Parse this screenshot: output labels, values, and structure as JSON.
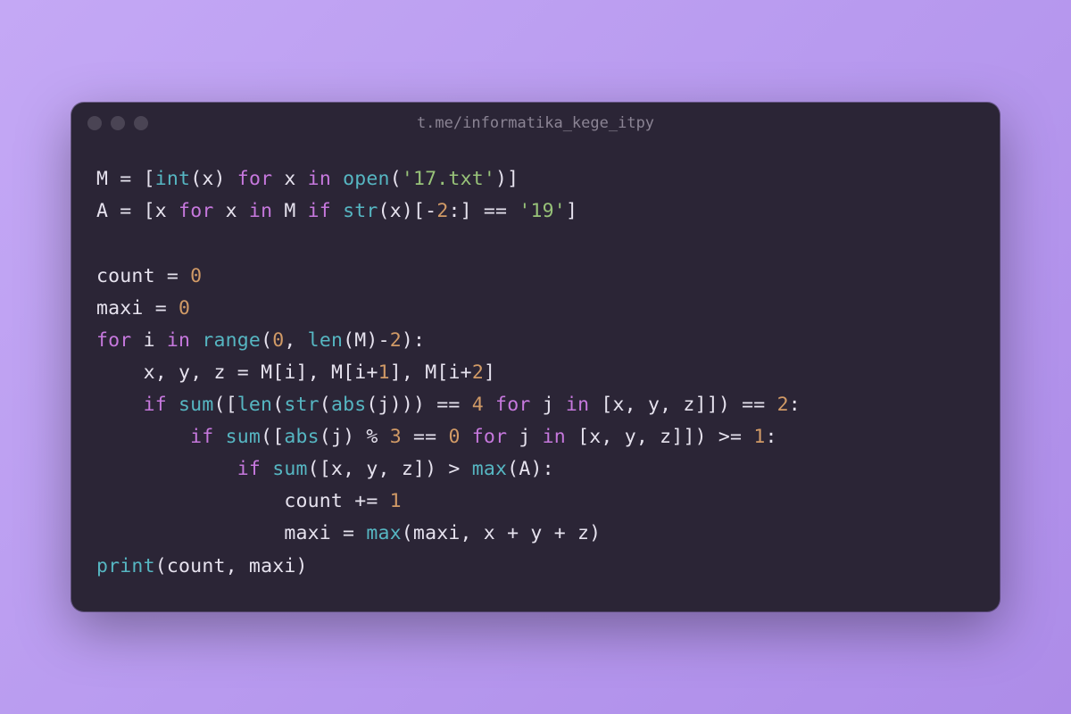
{
  "window": {
    "title": "t.me/informatika_kege_itpy"
  },
  "code": {
    "tokens": [
      [
        [
          "var",
          "M"
        ],
        [
          "op",
          " = "
        ],
        [
          "punc",
          "["
        ],
        [
          "builtin",
          "int"
        ],
        [
          "punc",
          "("
        ],
        [
          "var",
          "x"
        ],
        [
          "punc",
          ") "
        ],
        [
          "kw",
          "for"
        ],
        [
          "var",
          " x "
        ],
        [
          "kw",
          "in"
        ],
        [
          "punc",
          " "
        ],
        [
          "builtin",
          "open"
        ],
        [
          "punc",
          "("
        ],
        [
          "str",
          "'17.txt'"
        ],
        [
          "punc",
          ")]"
        ]
      ],
      [
        [
          "var",
          "A"
        ],
        [
          "op",
          " = "
        ],
        [
          "punc",
          "["
        ],
        [
          "var",
          "x "
        ],
        [
          "kw",
          "for"
        ],
        [
          "var",
          " x "
        ],
        [
          "kw",
          "in"
        ],
        [
          "var",
          " M "
        ],
        [
          "kw",
          "if"
        ],
        [
          "punc",
          " "
        ],
        [
          "builtin",
          "str"
        ],
        [
          "punc",
          "("
        ],
        [
          "var",
          "x"
        ],
        [
          "punc",
          ")["
        ],
        [
          "op",
          "-"
        ],
        [
          "num",
          "2"
        ],
        [
          "punc",
          ":] "
        ],
        [
          "op",
          "=="
        ],
        [
          "punc",
          " "
        ],
        [
          "str",
          "'19'"
        ],
        [
          "punc",
          "]"
        ]
      ],
      [],
      [
        [
          "var",
          "count"
        ],
        [
          "op",
          " = "
        ],
        [
          "num",
          "0"
        ]
      ],
      [
        [
          "var",
          "maxi"
        ],
        [
          "op",
          " = "
        ],
        [
          "num",
          "0"
        ]
      ],
      [
        [
          "kw",
          "for"
        ],
        [
          "var",
          " i "
        ],
        [
          "kw",
          "in"
        ],
        [
          "punc",
          " "
        ],
        [
          "builtin",
          "range"
        ],
        [
          "punc",
          "("
        ],
        [
          "num",
          "0"
        ],
        [
          "punc",
          ", "
        ],
        [
          "builtin",
          "len"
        ],
        [
          "punc",
          "("
        ],
        [
          "var",
          "M"
        ],
        [
          "punc",
          ")"
        ],
        [
          "op",
          "-"
        ],
        [
          "num",
          "2"
        ],
        [
          "punc",
          "):"
        ]
      ],
      [
        [
          "punc",
          "    "
        ],
        [
          "var",
          "x"
        ],
        [
          "punc",
          ", "
        ],
        [
          "var",
          "y"
        ],
        [
          "punc",
          ", "
        ],
        [
          "var",
          "z"
        ],
        [
          "op",
          " = "
        ],
        [
          "var",
          "M"
        ],
        [
          "punc",
          "["
        ],
        [
          "var",
          "i"
        ],
        [
          "punc",
          "], "
        ],
        [
          "var",
          "M"
        ],
        [
          "punc",
          "["
        ],
        [
          "var",
          "i"
        ],
        [
          "op",
          "+"
        ],
        [
          "num",
          "1"
        ],
        [
          "punc",
          "], "
        ],
        [
          "var",
          "M"
        ],
        [
          "punc",
          "["
        ],
        [
          "var",
          "i"
        ],
        [
          "op",
          "+"
        ],
        [
          "num",
          "2"
        ],
        [
          "punc",
          "]"
        ]
      ],
      [
        [
          "punc",
          "    "
        ],
        [
          "kw",
          "if"
        ],
        [
          "punc",
          " "
        ],
        [
          "builtin",
          "sum"
        ],
        [
          "punc",
          "(["
        ],
        [
          "builtin",
          "len"
        ],
        [
          "punc",
          "("
        ],
        [
          "builtin",
          "str"
        ],
        [
          "punc",
          "("
        ],
        [
          "builtin",
          "abs"
        ],
        [
          "punc",
          "("
        ],
        [
          "var",
          "j"
        ],
        [
          "punc",
          "))) "
        ],
        [
          "op",
          "=="
        ],
        [
          "punc",
          " "
        ],
        [
          "num",
          "4"
        ],
        [
          "punc",
          " "
        ],
        [
          "kw",
          "for"
        ],
        [
          "var",
          " j "
        ],
        [
          "kw",
          "in"
        ],
        [
          "punc",
          " ["
        ],
        [
          "var",
          "x"
        ],
        [
          "punc",
          ", "
        ],
        [
          "var",
          "y"
        ],
        [
          "punc",
          ", "
        ],
        [
          "var",
          "z"
        ],
        [
          "punc",
          "]]) "
        ],
        [
          "op",
          "=="
        ],
        [
          "punc",
          " "
        ],
        [
          "num",
          "2"
        ],
        [
          "punc",
          ":"
        ]
      ],
      [
        [
          "punc",
          "        "
        ],
        [
          "kw",
          "if"
        ],
        [
          "punc",
          " "
        ],
        [
          "builtin",
          "sum"
        ],
        [
          "punc",
          "(["
        ],
        [
          "builtin",
          "abs"
        ],
        [
          "punc",
          "("
        ],
        [
          "var",
          "j"
        ],
        [
          "punc",
          ") "
        ],
        [
          "op",
          "%"
        ],
        [
          "punc",
          " "
        ],
        [
          "num",
          "3"
        ],
        [
          "punc",
          " "
        ],
        [
          "op",
          "=="
        ],
        [
          "punc",
          " "
        ],
        [
          "num",
          "0"
        ],
        [
          "punc",
          " "
        ],
        [
          "kw",
          "for"
        ],
        [
          "var",
          " j "
        ],
        [
          "kw",
          "in"
        ],
        [
          "punc",
          " ["
        ],
        [
          "var",
          "x"
        ],
        [
          "punc",
          ", "
        ],
        [
          "var",
          "y"
        ],
        [
          "punc",
          ", "
        ],
        [
          "var",
          "z"
        ],
        [
          "punc",
          "]]) "
        ],
        [
          "op",
          ">="
        ],
        [
          "punc",
          " "
        ],
        [
          "num",
          "1"
        ],
        [
          "punc",
          ":"
        ]
      ],
      [
        [
          "punc",
          "            "
        ],
        [
          "kw",
          "if"
        ],
        [
          "punc",
          " "
        ],
        [
          "builtin",
          "sum"
        ],
        [
          "punc",
          "(["
        ],
        [
          "var",
          "x"
        ],
        [
          "punc",
          ", "
        ],
        [
          "var",
          "y"
        ],
        [
          "punc",
          ", "
        ],
        [
          "var",
          "z"
        ],
        [
          "punc",
          "]) "
        ],
        [
          "op",
          ">"
        ],
        [
          "punc",
          " "
        ],
        [
          "builtin",
          "max"
        ],
        [
          "punc",
          "("
        ],
        [
          "var",
          "A"
        ],
        [
          "punc",
          "):"
        ]
      ],
      [
        [
          "punc",
          "                "
        ],
        [
          "var",
          "count"
        ],
        [
          "op",
          " += "
        ],
        [
          "num",
          "1"
        ]
      ],
      [
        [
          "punc",
          "                "
        ],
        [
          "var",
          "maxi"
        ],
        [
          "op",
          " = "
        ],
        [
          "builtin",
          "max"
        ],
        [
          "punc",
          "("
        ],
        [
          "var",
          "maxi"
        ],
        [
          "punc",
          ", "
        ],
        [
          "var",
          "x"
        ],
        [
          "op",
          " + "
        ],
        [
          "var",
          "y"
        ],
        [
          "op",
          " + "
        ],
        [
          "var",
          "z"
        ],
        [
          "punc",
          ")"
        ]
      ],
      [
        [
          "builtin",
          "print"
        ],
        [
          "punc",
          "("
        ],
        [
          "var",
          "count"
        ],
        [
          "punc",
          ", "
        ],
        [
          "var",
          "maxi"
        ],
        [
          "punc",
          ")"
        ]
      ]
    ]
  }
}
